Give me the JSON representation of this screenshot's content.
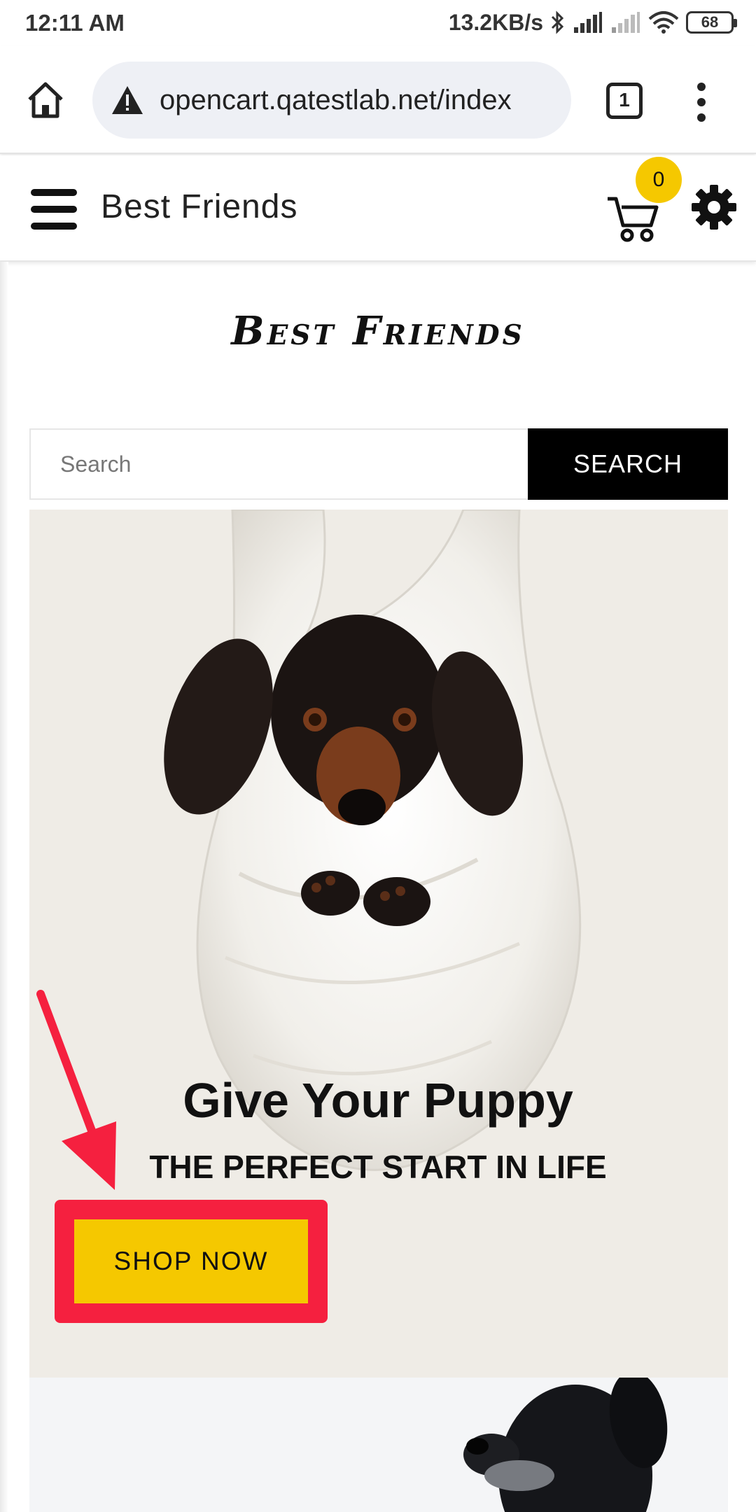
{
  "status_bar": {
    "time": "12:11 AM",
    "speed": "13.2KB/s",
    "battery": "68"
  },
  "browser": {
    "url": "opencart.qatestlab.net/index",
    "tab_count": "1"
  },
  "site_header": {
    "title": "Best Friends",
    "cart_count": "0"
  },
  "logo_text": "Best Friends",
  "search": {
    "placeholder": "Search",
    "button_label": "SEARCH"
  },
  "hero": {
    "title": "Give Your Puppy",
    "subtitle": "THE PERFECT START IN LIFE",
    "cta_label": "SHOP NOW"
  },
  "colors": {
    "accent_yellow": "#f5c800",
    "highlight_red": "#f5203f",
    "search_button": "#000000"
  },
  "icons": [
    "home-icon",
    "warning-icon",
    "tabs-icon",
    "more-vert-icon",
    "hamburger-icon",
    "cart-icon",
    "gear-icon",
    "bluetooth-icon",
    "signal-icon",
    "wifi-icon",
    "battery-icon"
  ]
}
